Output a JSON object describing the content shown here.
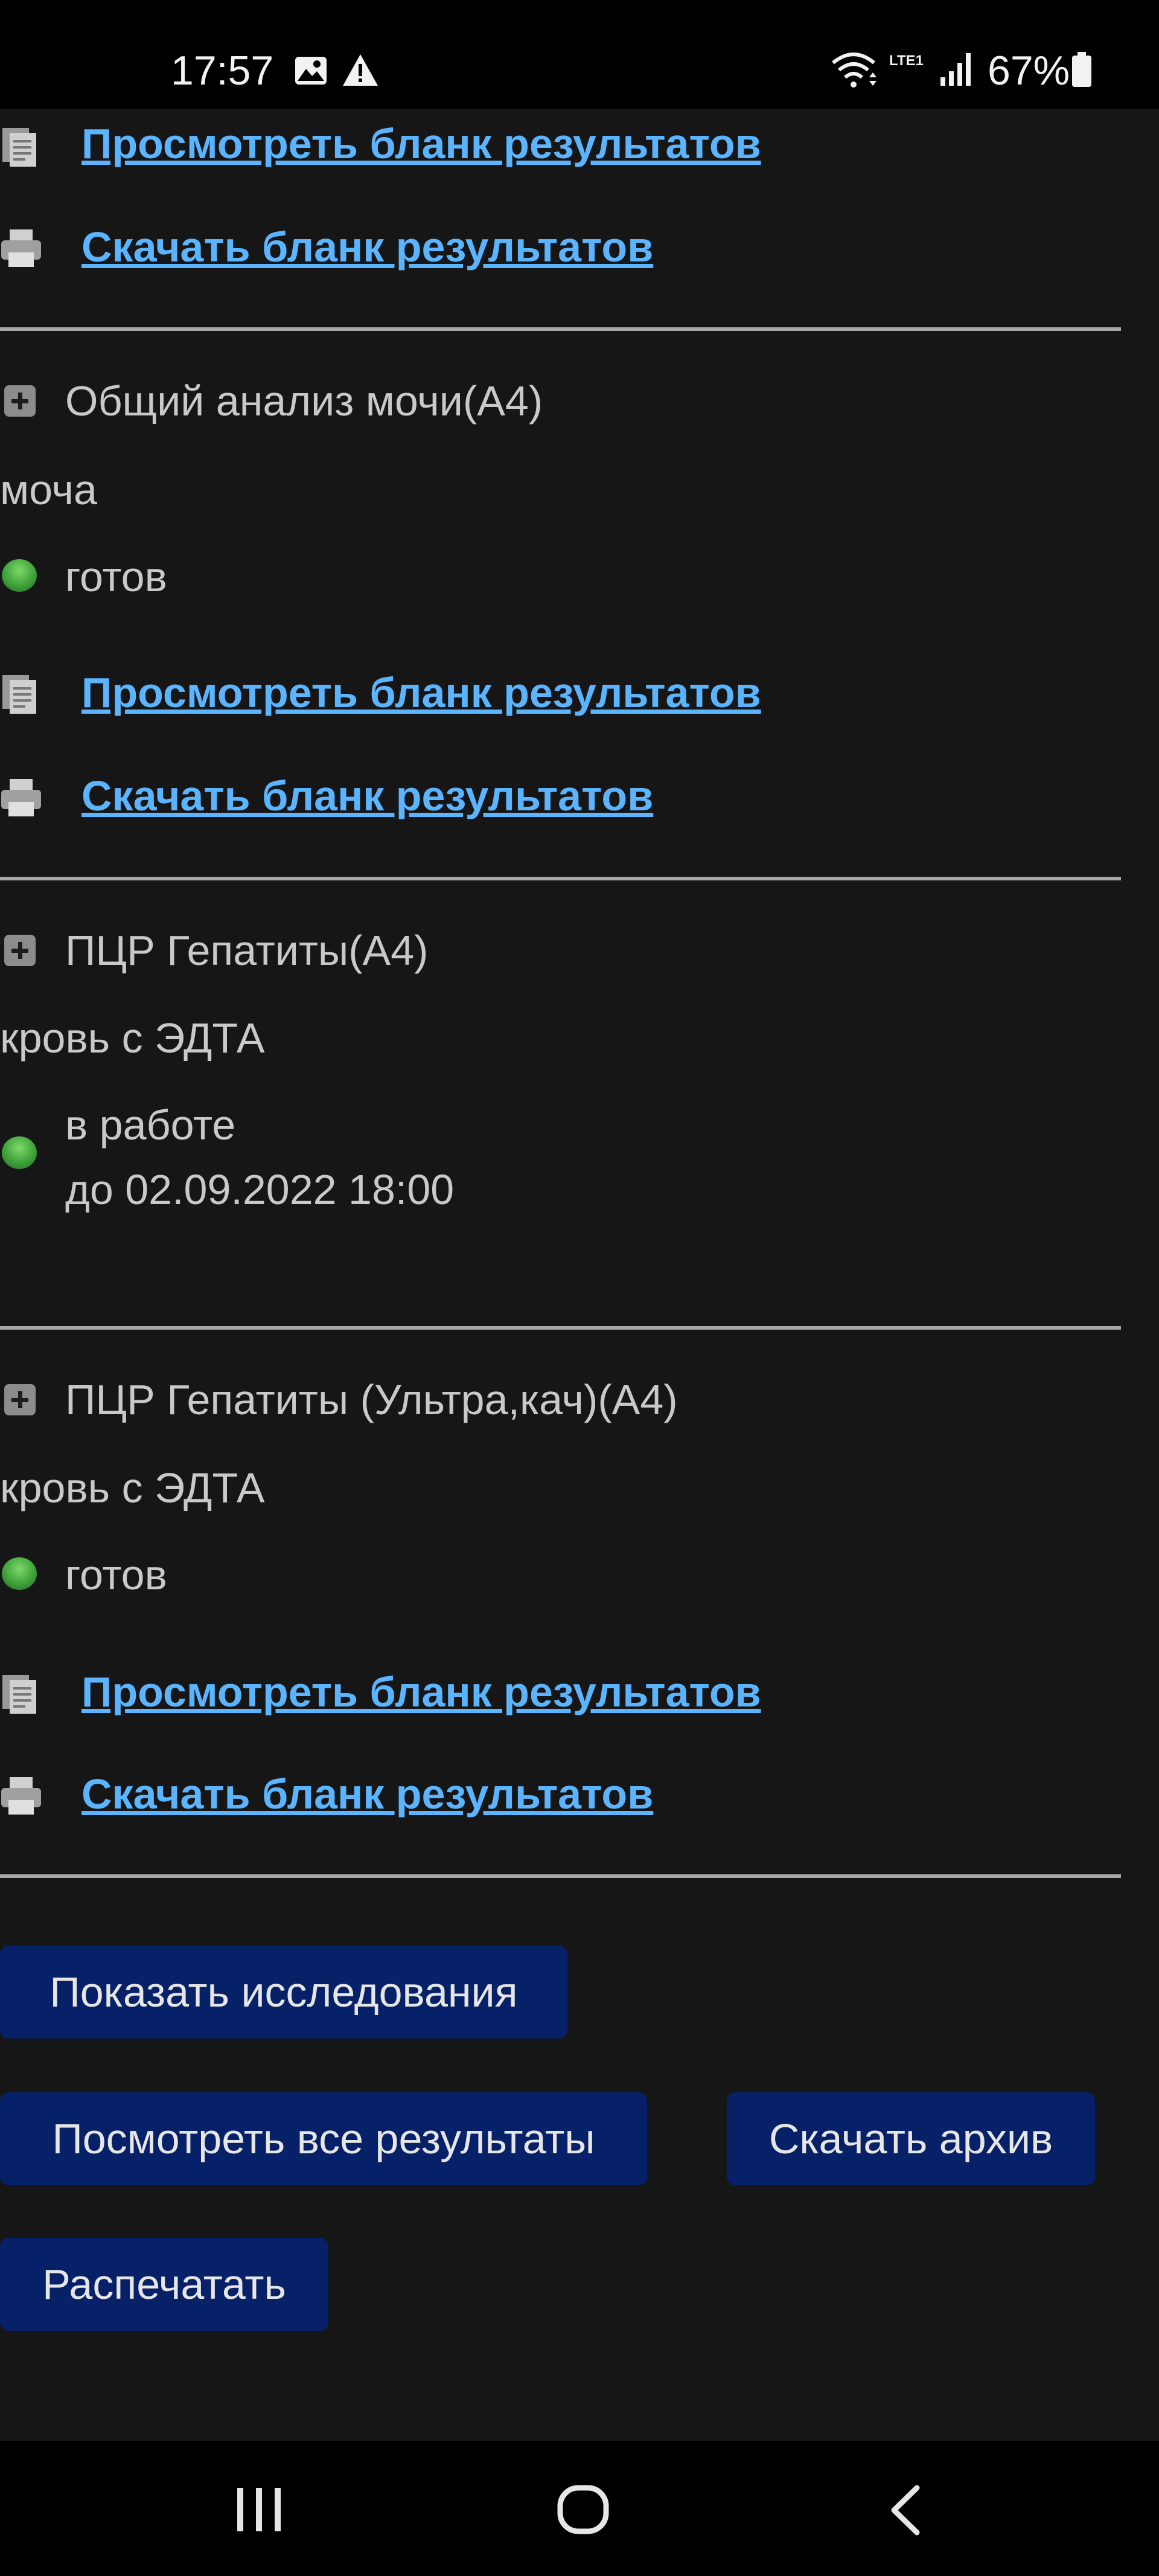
{
  "status_bar": {
    "time": "17:57",
    "network_label": "LTE1",
    "battery_percent": "67%"
  },
  "colors": {
    "link": "#5ab4ff",
    "button_bg": "#062167",
    "status_ready": "#3ea23a",
    "background": "#161617"
  },
  "top_partial": {
    "view_link": "Просмотреть бланк результатов",
    "download_link": "Скачать бланк результатов"
  },
  "items": [
    {
      "title": "Общий анализ мочи(А4)",
      "sample": "моча",
      "status": "готов",
      "view_link": "Просмотреть бланк результатов",
      "download_link": "Скачать бланк результатов"
    },
    {
      "title": "ПЦР Гепатиты(А4)",
      "sample": "кровь с ЭДТА",
      "status": "в работе",
      "status_due": "до 02.09.2022 18:00"
    },
    {
      "title": "ПЦР Гепатиты (Ультра,кач)(А4)",
      "sample": "кровь с ЭДТА",
      "status": "готов",
      "view_link": "Просмотреть бланк результатов",
      "download_link": "Скачать бланк результатов"
    }
  ],
  "buttons": {
    "show_studies": "Показать исследования",
    "view_all": "Посмотреть все результаты",
    "download_archive": "Скачать архив",
    "print": "Распечатать"
  }
}
